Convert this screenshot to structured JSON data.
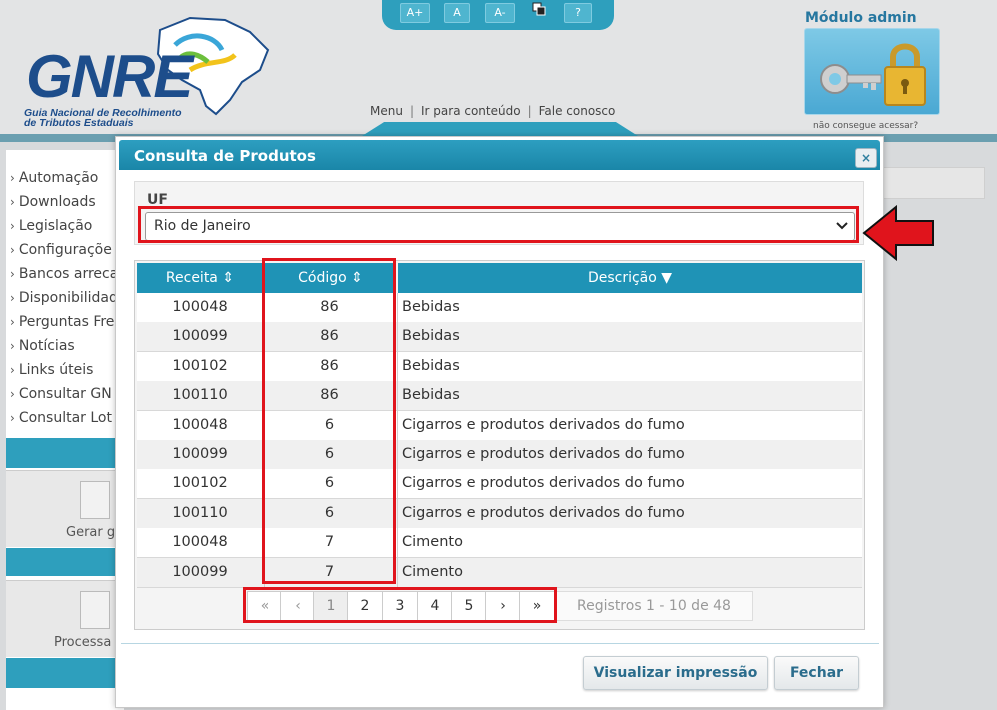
{
  "header": {
    "logo_text": "GNRE",
    "logo_sub_1": "Guia Nacional de Recolhimento",
    "logo_sub_2": "de Tributos Estaduais",
    "accessibility": {
      "increase": "A+",
      "normal": "A",
      "decrease": "A-",
      "help": "?"
    },
    "links": {
      "menu": "Menu",
      "content": "Ir para conteúdo",
      "contact": "Fale conosco"
    },
    "admin": {
      "title": "Módulo admin",
      "note": "não consegue acessar?"
    }
  },
  "sidebar": {
    "items": [
      {
        "label": "Automação"
      },
      {
        "label": "Downloads"
      },
      {
        "label": "Legislação"
      },
      {
        "label": "Configuraçõe"
      },
      {
        "label": "Bancos arreca"
      },
      {
        "label": "Disponibilidad"
      },
      {
        "label": "Perguntas Fre"
      },
      {
        "label": "Notícias"
      },
      {
        "label": "Links úteis"
      },
      {
        "label": "Consultar GN"
      },
      {
        "label": "Consultar Lot"
      }
    ],
    "cards": [
      {
        "label": "Gerar g"
      },
      {
        "label": "Processa"
      }
    ]
  },
  "modal": {
    "title": "Consulta de Produtos",
    "close": "×",
    "uf": {
      "label": "UF",
      "selected": "Rio de Janeiro"
    },
    "table": {
      "headers": [
        "Receita",
        "Código",
        "Descrição"
      ],
      "sort_icons": [
        "⇕",
        "⇕",
        "▼"
      ],
      "rows": [
        [
          "100048",
          "86",
          "Bebidas"
        ],
        [
          "100099",
          "86",
          "Bebidas"
        ],
        [
          "100102",
          "86",
          "Bebidas"
        ],
        [
          "100110",
          "86",
          "Bebidas"
        ],
        [
          "100048",
          "6",
          "Cigarros e produtos derivados do fumo"
        ],
        [
          "100099",
          "6",
          "Cigarros e produtos derivados do fumo"
        ],
        [
          "100102",
          "6",
          "Cigarros e produtos derivados do fumo"
        ],
        [
          "100110",
          "6",
          "Cigarros e produtos derivados do fumo"
        ],
        [
          "100048",
          "7",
          "Cimento"
        ],
        [
          "100099",
          "7",
          "Cimento"
        ]
      ]
    },
    "pagination": {
      "first": "«",
      "prev": "‹",
      "pages": [
        "1",
        "2",
        "3",
        "4",
        "5"
      ],
      "next": "›",
      "last": "»",
      "info": "Registros 1 - 10 de 48"
    },
    "buttons": {
      "print": "Visualizar impressão",
      "close": "Fechar"
    }
  },
  "colors": {
    "accent": "#1f93b6",
    "highlight": "#e0141c"
  }
}
